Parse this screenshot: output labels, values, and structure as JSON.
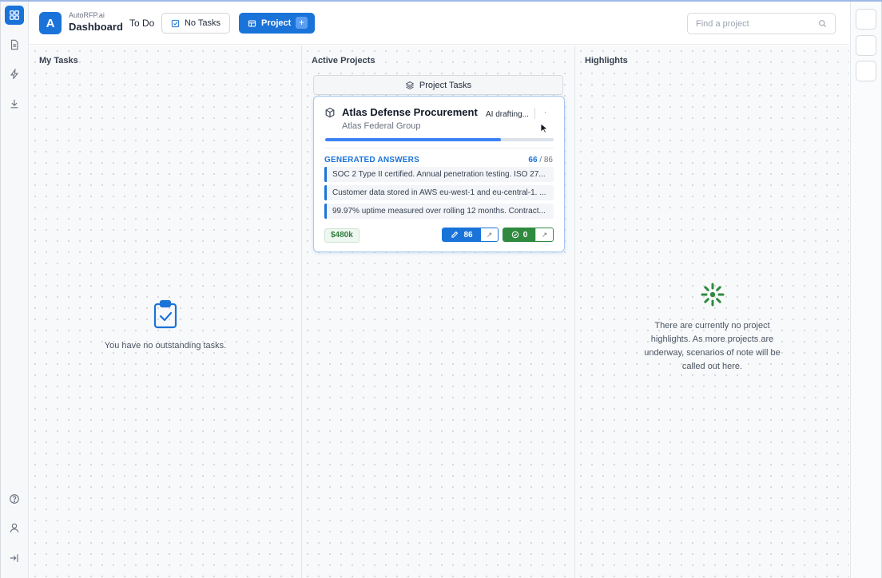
{
  "colors": {
    "accent": "#1a73d9",
    "success": "#2f8a3f",
    "progress": "#3b82f6"
  },
  "sidebar": {
    "top_icons": [
      "grid-icon",
      "document-icon",
      "lightning-icon",
      "download-icon"
    ],
    "bottom_icons": [
      "help-icon",
      "user-icon",
      "logout-icon"
    ]
  },
  "header": {
    "logo_letter": "A",
    "brand": "AutoRFP.ai",
    "title": "Dashboard",
    "todo_label": "To Do",
    "no_tasks_label": "No Tasks",
    "project_label": "Project",
    "project_plus": "+",
    "search_placeholder": "Find a project"
  },
  "my_tasks": {
    "title": "My Tasks",
    "empty_text": "You have no outstanding tasks."
  },
  "active_projects": {
    "title": "Active Projects",
    "project_tasks_label": "Project Tasks",
    "card": {
      "title": "Atlas Defense Procurement",
      "client": "Atlas Federal Group",
      "ai_status": "AI drafting...",
      "more": "·",
      "progress": 0.77,
      "generated_label": "GENERATED ANSWERS",
      "generated_done": "66",
      "generated_total": "/ 86",
      "answers": [
        "SOC 2 Type II certified. Annual penetration testing. ISO 27...",
        "Customer data stored in AWS eu-west-1 and eu-central-1. ...",
        "99.97% uptime measured over rolling 12 months. Contract..."
      ],
      "budget": "$480k",
      "edit_count": "86",
      "approved_count": "0",
      "open_glyph": "↗"
    }
  },
  "highlights": {
    "title": "Highlights",
    "empty_text": "There are currently no project highlights. As more projects are underway, scenarios of note will be called out here."
  }
}
